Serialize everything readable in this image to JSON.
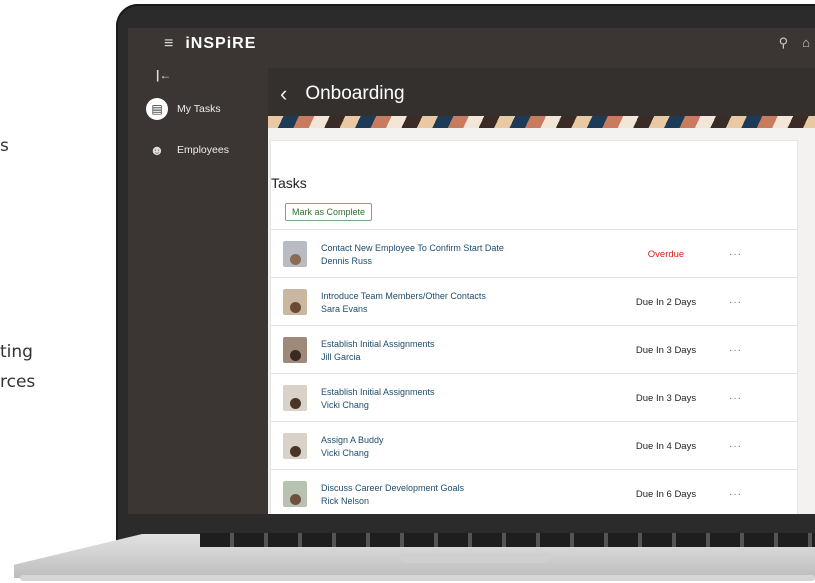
{
  "background_fragments": [
    "s",
    "ting",
    "rces"
  ],
  "app": {
    "brand": "iNSPiRE"
  },
  "sidebar": {
    "items": [
      {
        "label": "My Tasks"
      },
      {
        "label": "Employees"
      }
    ]
  },
  "header": {
    "title": "Onboarding"
  },
  "tasks": {
    "section_title": "Tasks",
    "mark_complete_label": "Mark as Complete",
    "rows": [
      {
        "task": "Contact New Employee To Confirm Start Date",
        "person": "Dennis Russ",
        "due": "Overdue",
        "status": "overdue"
      },
      {
        "task": "Introduce Team Members/Other Contacts",
        "person": "Sara Evans",
        "due": "Due In 2 Days",
        "status": "normal"
      },
      {
        "task": "Establish Initial Assignments",
        "person": "Jill Garcia",
        "due": "Due In 3 Days",
        "status": "normal"
      },
      {
        "task": "Establish Initial Assignments",
        "person": "Vicki Chang",
        "due": "Due In 3 Days",
        "status": "normal"
      },
      {
        "task": "Assign A Buddy",
        "person": "Vicki Chang",
        "due": "Due In 4 Days",
        "status": "normal"
      },
      {
        "task": "Discuss Career Development Goals",
        "person": "Rick Nelson",
        "due": "Due In 6 Days",
        "status": "normal"
      }
    ]
  },
  "colors": {
    "sidebar_bg": "#3b3633",
    "link": "#1e4d6b",
    "overdue": "#d1221b",
    "button_border": "#7aa77a"
  }
}
